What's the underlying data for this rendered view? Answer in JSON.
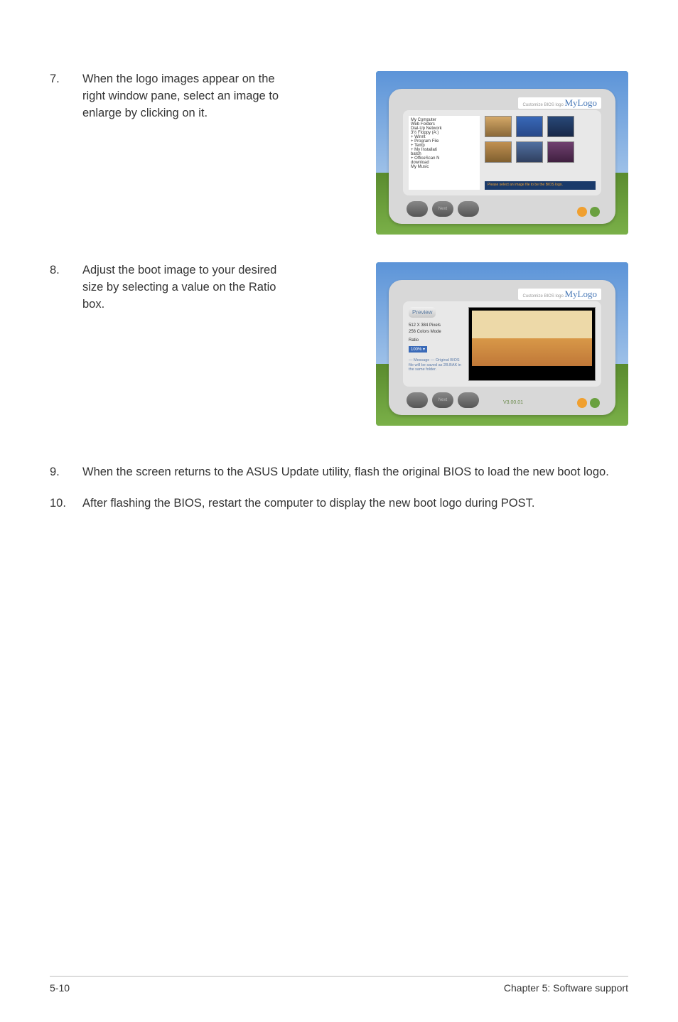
{
  "steps": {
    "7": {
      "num": "7.",
      "text": "When the logo images appear on the right window pane, select an image to enlarge by clicking on it."
    },
    "8": {
      "num": "8.",
      "text": "Adjust the boot image to your desired size by selecting a value on the Ratio box."
    },
    "9": {
      "num": "9.",
      "text": "When the screen returns to the ASUS Update utility, flash the original BIOS to load the new boot logo."
    },
    "10": {
      "num": "10.",
      "text": "After flashing the BIOS, restart the computer to display the new boot logo during POST."
    }
  },
  "screenshot1": {
    "brand": "MyLogo",
    "tree": [
      "My Computer",
      "  Web Folders",
      "  Dial-Up Network",
      "  3½ Floppy (A:)",
      "  + Winnt",
      "  + Program File",
      "  + Temp",
      "  + My Installati",
      "    batch",
      "  + OfficeScan N",
      "    download",
      "    My Music"
    ],
    "status": "Please select an image file to be the BIOS logo."
  },
  "screenshot2": {
    "brand": "MyLogo",
    "preview_label": "Preview",
    "pixels": "512 X 384 Pixels",
    "colors": "256 Colors Mode",
    "ratio_label": "Ratio",
    "ratio_value": "100% ▾",
    "message": "— Message —\nOriginal BIOS file will be saved as 2B.BAK in the same folder.",
    "version": "V3.00.01"
  },
  "buttons": {
    "back": "",
    "next": "Next",
    "cancel": ""
  },
  "footer": {
    "page": "5-10",
    "chapter": "Chapter 5: Software support"
  }
}
